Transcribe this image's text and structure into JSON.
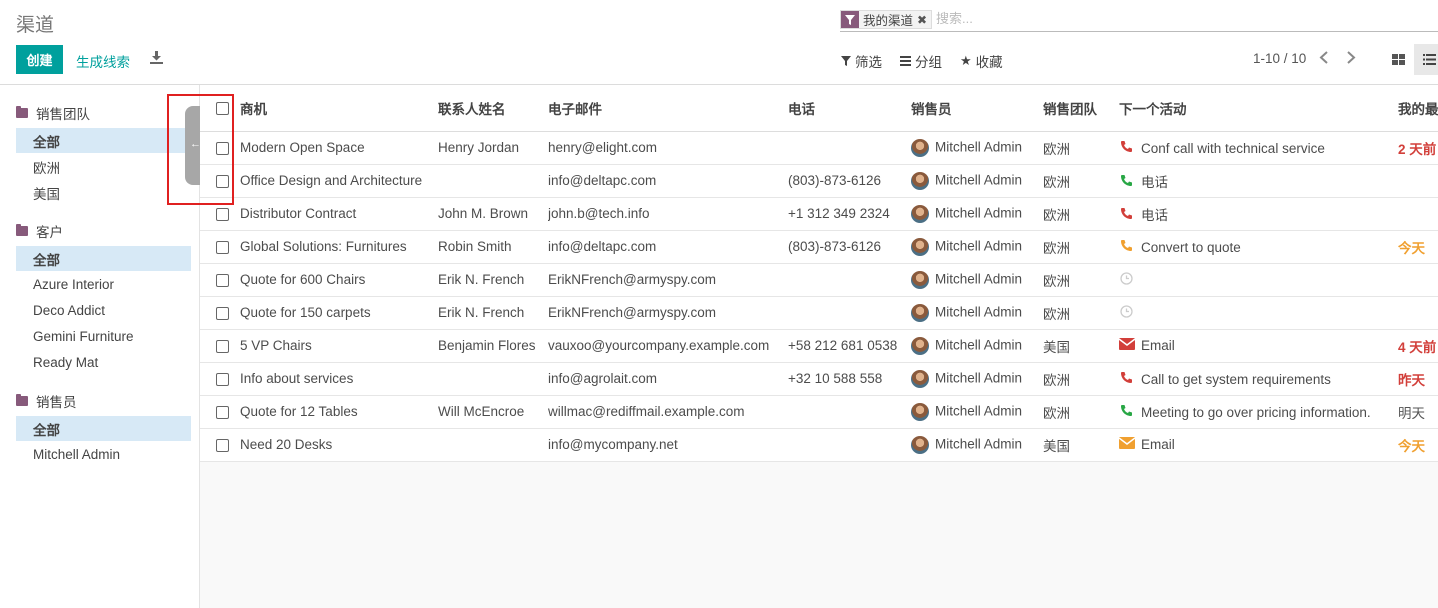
{
  "page": {
    "title": "渠道",
    "search": {
      "facet": "我的渠道",
      "placeholder": "搜索..."
    },
    "buttons": {
      "create": "创建",
      "generate_leads": "生成线索"
    },
    "filters": {
      "filter": "筛选",
      "group_by": "分组",
      "favorites": "收藏"
    },
    "pager": "1-10 / 10"
  },
  "sidepanel": {
    "sections": [
      {
        "header": "销售团队",
        "items": [
          "全部",
          "欧洲",
          "美国"
        ],
        "active": 0
      },
      {
        "header": "客户",
        "items": [
          "全部",
          "Azure Interior",
          "Deco Addict",
          "Gemini Furniture",
          "Ready Mat"
        ],
        "active": 0
      },
      {
        "header": "销售员",
        "items": [
          "全部",
          "Mitchell Admin"
        ],
        "active": 0
      }
    ]
  },
  "table": {
    "headers": [
      "商机",
      "联系人姓名",
      "电子邮件",
      "电话",
      "销售员",
      "销售团队",
      "下一个活动",
      "我的最"
    ],
    "rows": [
      {
        "name": "Modern Open Space",
        "contact": "Henry Jordan",
        "email": "henry@elight.com",
        "phone": "",
        "salesperson": "Mitchell Admin",
        "team": "欧洲",
        "activity": "Conf call with technical service",
        "activity_icon": "phone-red",
        "deadline": "2 天前"
      },
      {
        "name": "Office Design and Architecture",
        "contact": "",
        "email": "info@deltapc.com",
        "phone": "(803)-873-6126",
        "salesperson": "Mitchell Admin",
        "team": "欧洲",
        "activity": "电话",
        "activity_icon": "phone-green",
        "deadline": ""
      },
      {
        "name": "Distributor Contract",
        "contact": "John M. Brown",
        "email": "john.b@tech.info",
        "phone": "+1 312 349 2324",
        "salesperson": "Mitchell Admin",
        "team": "欧洲",
        "activity": "电话",
        "activity_icon": "phone-red",
        "deadline": ""
      },
      {
        "name": "Global Solutions: Furnitures",
        "contact": "Robin Smith",
        "email": "info@deltapc.com",
        "phone": "(803)-873-6126",
        "salesperson": "Mitchell Admin",
        "team": "欧洲",
        "activity": "Convert to quote",
        "activity_icon": "phone-orange",
        "deadline": "今天"
      },
      {
        "name": "Quote for 600 Chairs",
        "contact": "Erik N. French",
        "email": "ErikNFrench@armyspy.com",
        "phone": "",
        "salesperson": "Mitchell Admin",
        "team": "欧洲",
        "activity": "",
        "activity_icon": "clock-grey",
        "deadline": ""
      },
      {
        "name": "Quote for 150 carpets",
        "contact": "Erik N. French",
        "email": "ErikNFrench@armyspy.com",
        "phone": "",
        "salesperson": "Mitchell Admin",
        "team": "欧洲",
        "activity": "",
        "activity_icon": "clock-grey",
        "deadline": ""
      },
      {
        "name": "5 VP Chairs",
        "contact": "Benjamin Flores",
        "email": "vauxoo@yourcompany.example.com",
        "phone": "+58 212 681 0538",
        "salesperson": "Mitchell Admin",
        "team": "美国",
        "activity": "Email",
        "activity_icon": "email-red",
        "deadline": "4 天前"
      },
      {
        "name": "Info about services",
        "contact": "",
        "email": "info@agrolait.com",
        "phone": "+32 10 588 558",
        "salesperson": "Mitchell Admin",
        "team": "欧洲",
        "activity": "Call to get system requirements",
        "activity_icon": "phone-red",
        "deadline": "昨天"
      },
      {
        "name": "Quote for 12 Tables",
        "contact": "Will McEncroe",
        "email": "willmac@rediffmail.example.com",
        "phone": "",
        "salesperson": "Mitchell Admin",
        "team": "欧洲",
        "activity": "Meeting to go over pricing information.",
        "activity_icon": "phone-green",
        "deadline": "明天"
      },
      {
        "name": "Need 20 Desks",
        "contact": "",
        "email": "info@mycompany.net",
        "phone": "",
        "salesperson": "Mitchell Admin",
        "team": "美国",
        "activity": "Email",
        "activity_icon": "email-orange",
        "deadline": "今天"
      }
    ]
  },
  "colors": {
    "brand": "#875a7b",
    "accent": "#00a09d",
    "danger": "#e02020",
    "overdue": "#d23f3a",
    "today": "#f0a030",
    "planned": "#555555",
    "phone_green": "#28a745"
  }
}
